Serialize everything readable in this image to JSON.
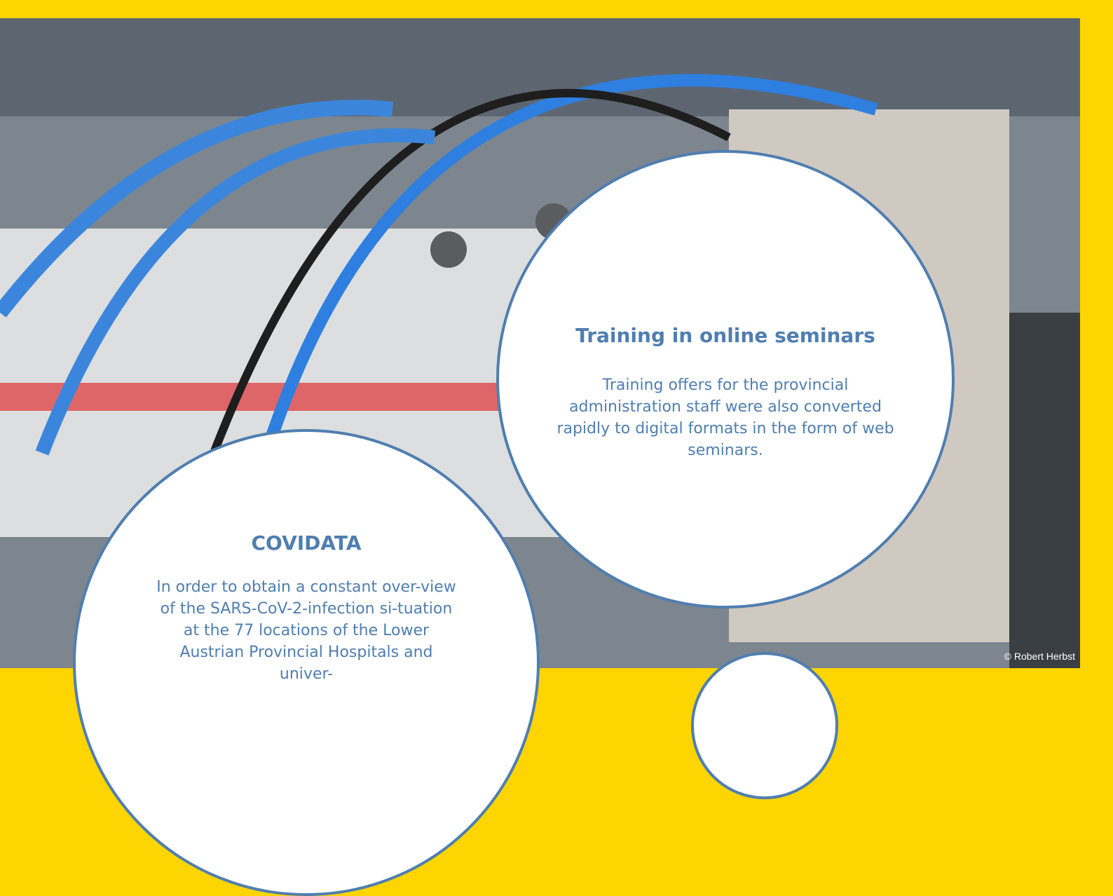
{
  "card_training": {
    "title": "Training in online seminars",
    "body": "Training offers for the provincial administration staff were also converted rapidly to digital formats in the form of web seminars."
  },
  "card_covidata": {
    "title": "COVIDATA",
    "body": "In order to obtain a constant over-view of the SARS-CoV-2-infection si-tuation at the 77 locations of the Lower Austrian Provincial Hospitals and univer-"
  },
  "photo_credit": "© Robert Herbst",
  "colors": {
    "frame": "#ffd500",
    "accent": "#4f7eb0"
  }
}
